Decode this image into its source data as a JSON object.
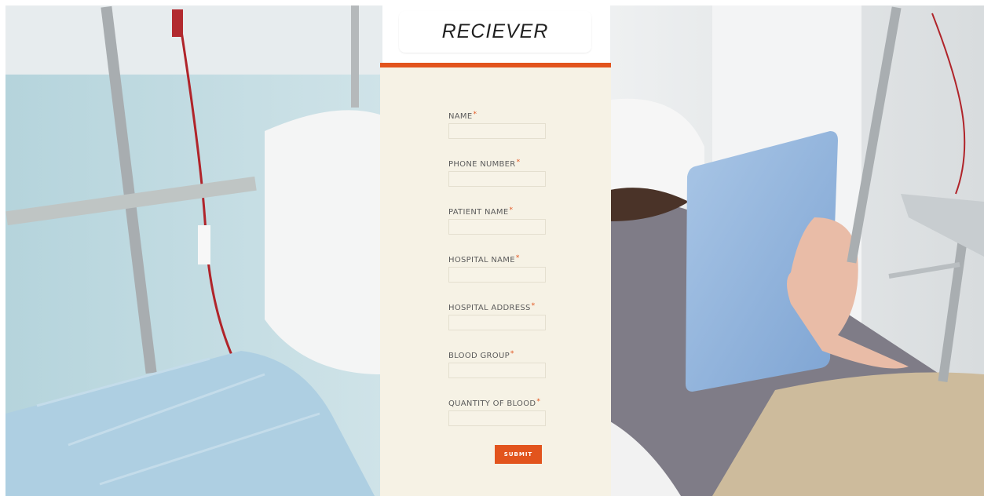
{
  "page": {
    "title": "RECIEVER"
  },
  "form": {
    "required_marker": "*",
    "fields": [
      {
        "label": "NAME",
        "value": ""
      },
      {
        "label": "PHONE NUMBER",
        "value": ""
      },
      {
        "label": "PATIENT NAME",
        "value": ""
      },
      {
        "label": "HOSPITAL NAME",
        "value": ""
      },
      {
        "label": "HOSPITAL ADDRESS",
        "value": ""
      },
      {
        "label": "BLOOD GROUP",
        "value": ""
      },
      {
        "label": "QUANTITY OF BLOOD",
        "value": ""
      }
    ],
    "submit_label": "SUBMIT"
  },
  "colors": {
    "accent": "#e2541d",
    "panel_background": "#f6f2e5",
    "title_card": "#ffffff"
  },
  "background": {
    "depicts": "hospital-patient-photo"
  }
}
